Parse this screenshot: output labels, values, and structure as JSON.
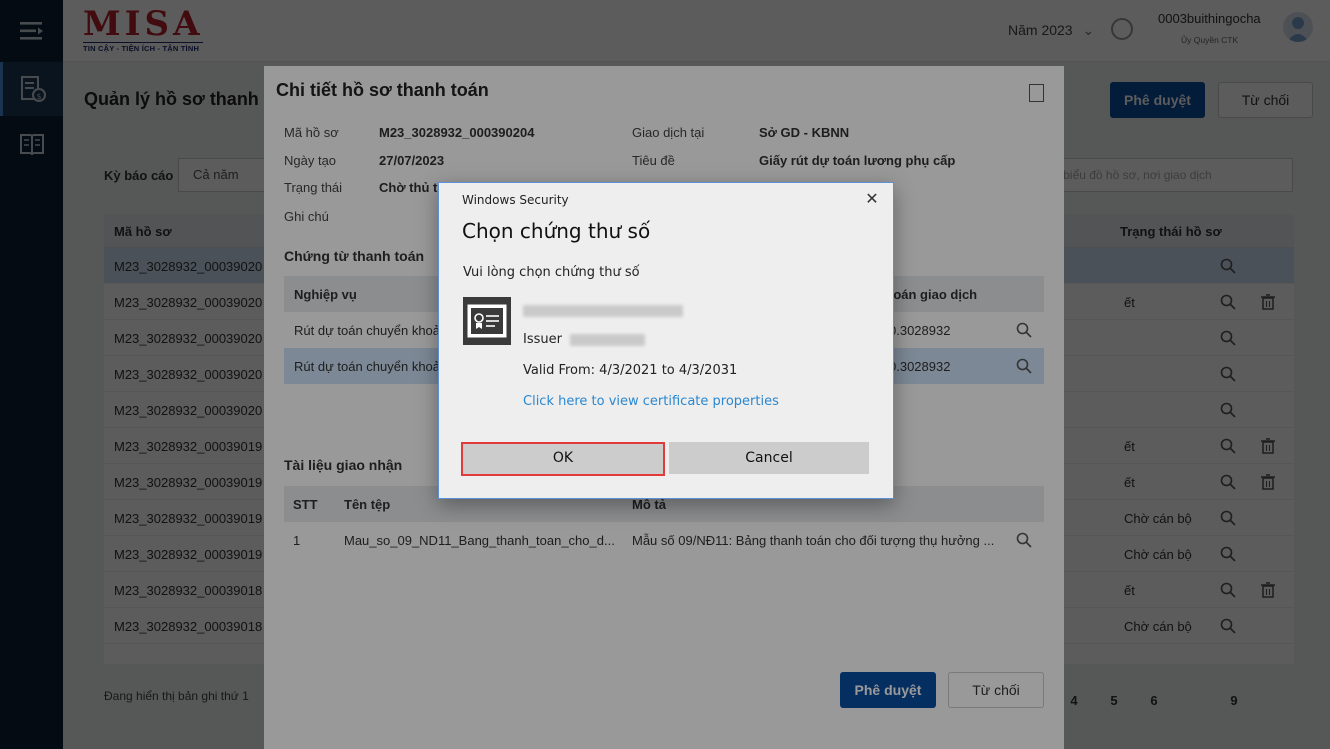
{
  "header": {
    "logo": "MISA",
    "logo_tagline": "TIN CẬY - TIỆN ÍCH - TẬN TÌNH",
    "year": "Năm 2023",
    "user_name": "0003buithingocha",
    "user_role": "Ủy Quyền CTK"
  },
  "page": {
    "title": "Quản lý hồ sơ thanh to",
    "approve_label": "Phê duyệt",
    "reject_label": "Từ chối",
    "filter_label": "Kỳ báo cáo",
    "filter_value": "Cả năm",
    "search_placeholder": "mã hồ sơ, biểu đồ hồ sơ, nơi giao dịch",
    "table": {
      "headers": [
        "Mã hồ sơ",
        "Trạng thái hồ sơ"
      ],
      "rows": [
        {
          "id": "M23_3028932_00039020",
          "status": "",
          "trash": false,
          "selected": true
        },
        {
          "id": "M23_3028932_00039020",
          "status": "ết",
          "trash": true,
          "selected": false
        },
        {
          "id": "M23_3028932_00039020",
          "status": "",
          "trash": false,
          "selected": false
        },
        {
          "id": "M23_3028932_00039020",
          "status": "",
          "trash": false,
          "selected": false
        },
        {
          "id": "M23_3028932_00039020",
          "status": "",
          "trash": false,
          "selected": false
        },
        {
          "id": "M23_3028932_00039019",
          "status": "ết",
          "trash": true,
          "selected": false
        },
        {
          "id": "M23_3028932_00039019",
          "status": "ết",
          "trash": true,
          "selected": false
        },
        {
          "id": "M23_3028932_00039019",
          "status": "Chờ cán bộ",
          "trash": false,
          "selected": false
        },
        {
          "id": "M23_3028932_00039019",
          "status": "Chờ cán bộ",
          "trash": false,
          "selected": false
        },
        {
          "id": "M23_3028932_00039018",
          "status": "ết",
          "trash": true,
          "selected": false
        },
        {
          "id": "M23_3028932_00039018",
          "status": "Chờ cán bộ",
          "trash": false,
          "selected": false
        }
      ]
    },
    "footer_text": "Đang hiển thị bản ghi thứ 1",
    "pages": [
      "4",
      "5",
      "6",
      "9"
    ]
  },
  "modal": {
    "title": "Chi tiết hồ sơ thanh toán",
    "fields": {
      "ma_ho_so_label": "Mã hồ sơ",
      "ma_ho_so": "M23_3028932_000390204",
      "ngay_tao_label": "Ngày tạo",
      "ngay_tao": "27/07/2023",
      "trang_thai_label": "Trạng thái",
      "trang_thai": "Chờ thủ trư",
      "ghi_chu_label": "Ghi chú",
      "giao_dich_label": "Giao dịch tại",
      "giao_dich": "Sở GD - KBNN",
      "tieu_de_label": "Tiêu đề",
      "tieu_de": "Giấy rút dự toán lương phụ cấp"
    },
    "chung_tu": {
      "title": "Chứng từ thanh toán",
      "col_nghiep_vu": "Nghiệp vụ",
      "col_ma_giao_dich": "toán giao dịch",
      "rows": [
        {
          "nghiep_vu": "Rút dự toán chuyển khoả",
          "ma": "0.3028932"
        },
        {
          "nghiep_vu": "Rút dự toán chuyển khoả",
          "ma": "0.3028932"
        }
      ]
    },
    "tai_lieu": {
      "title": "Tài liệu giao nhận",
      "col_stt": "STT",
      "col_ten_tep": "Tên tệp",
      "col_mo_ta": "Mô tả",
      "rows": [
        {
          "stt": "1",
          "ten_tep": "Mau_so_09_ND11_Bang_thanh_toan_cho_d...",
          "mo_ta": "Mẫu số 09/NĐ11: Bảng thanh toán cho đối tượng thụ hưởng ..."
        }
      ]
    },
    "approve_label": "Phê duyệt",
    "reject_label": "Từ chối"
  },
  "win_dialog": {
    "caption": "Windows Security",
    "title": "Chọn chứng thư số",
    "subtitle": "Vui lòng chọn chứng thư số",
    "issuer_label": "Issuer",
    "valid": "Valid From: 4/3/2021 to 4/3/2031",
    "link": "Click here to view certificate properties",
    "ok_label": "OK",
    "cancel_label": "Cancel"
  },
  "colors": {
    "primary": "#0a4fa2",
    "sidebar": "#0d2134",
    "link": "#2a87d0",
    "highlight": "#e03a3a"
  }
}
